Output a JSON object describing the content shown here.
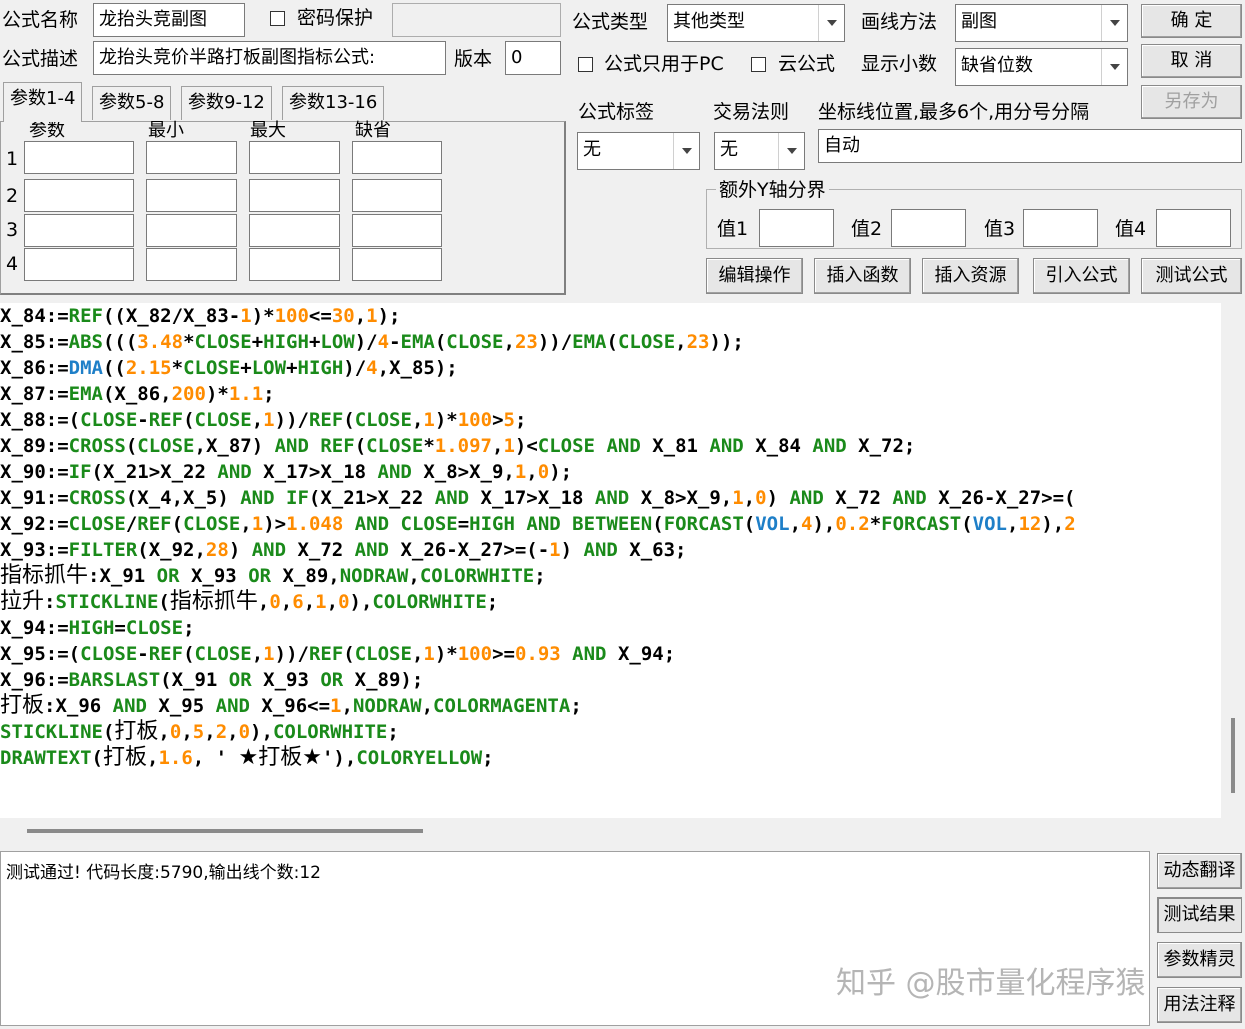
{
  "formula": {
    "name_label": "公式名称",
    "name_value": "龙抬头竞副图",
    "password_label": "密码保护",
    "desc_label": "公式描述",
    "desc_value": "龙抬头竞价半路打板副图指标公式:",
    "version_label": "版本",
    "version_value": "0",
    "type_label": "公式类型",
    "type_value": "其他类型",
    "draw_label": "画线方法",
    "draw_value": "副图",
    "pc_only_label": "公式只用于PC",
    "cloud_label": "云公式",
    "decimals_label": "显示小数",
    "decimals_value": "缺省位数",
    "tag_label": "公式标签",
    "tag_value": "无",
    "rule_label": "交易法则",
    "rule_value": "无",
    "axis_label": "坐标线位置,最多6个,用分号分隔",
    "axis_value": "自动"
  },
  "buttons": {
    "ok": "确  定",
    "cancel": "取  消",
    "save_as": "另存为",
    "edit": "编辑操作",
    "insert_func": "插入函数",
    "insert_res": "插入资源",
    "import": "引入公式",
    "test": "测试公式",
    "dyn_translate": "动态翻译",
    "test_result": "测试结果",
    "param_wizard": "参数精灵",
    "usage_notes": "用法注释"
  },
  "tabs": [
    "参数1-4",
    "参数5-8",
    "参数9-12",
    "参数13-16"
  ],
  "params": {
    "headers": [
      "参数",
      "最小",
      "最大",
      "缺省"
    ],
    "rows": [
      "1",
      "2",
      "3",
      "4"
    ]
  },
  "yaxis": {
    "group_label": "额外Y轴分界",
    "labels": [
      "值1",
      "值2",
      "值3",
      "值4"
    ]
  },
  "code_lines": [
    [
      [
        "X_84:=",
        "t"
      ],
      [
        "REF",
        "k"
      ],
      [
        "((X_82/X_83-",
        "t"
      ],
      [
        "1",
        "n"
      ],
      [
        ")*",
        "t"
      ],
      [
        "100",
        "n"
      ],
      [
        "<=",
        "t"
      ],
      [
        "30",
        "n"
      ],
      [
        ",",
        "t"
      ],
      [
        "1",
        "n"
      ],
      [
        ");",
        "t"
      ]
    ],
    [
      [
        "X_85:=",
        "t"
      ],
      [
        "ABS",
        "k"
      ],
      [
        "(((",
        "t"
      ],
      [
        "3.48",
        "n"
      ],
      [
        "*",
        "t"
      ],
      [
        "CLOSE",
        "k"
      ],
      [
        "+",
        "t"
      ],
      [
        "HIGH",
        "k"
      ],
      [
        "+",
        "t"
      ],
      [
        "LOW",
        "k"
      ],
      [
        ")/",
        "t"
      ],
      [
        "4",
        "n"
      ],
      [
        "-",
        "t"
      ],
      [
        "EMA",
        "k"
      ],
      [
        "(",
        "t"
      ],
      [
        "CLOSE",
        "k"
      ],
      [
        ",",
        "t"
      ],
      [
        "23",
        "n"
      ],
      [
        "))/",
        "t"
      ],
      [
        "EMA",
        "k"
      ],
      [
        "(",
        "t"
      ],
      [
        "CLOSE",
        "k"
      ],
      [
        ",",
        "t"
      ],
      [
        "23",
        "n"
      ],
      [
        "));",
        "t"
      ]
    ],
    [
      [
        "X_86:=",
        "t"
      ],
      [
        "DMA",
        "b"
      ],
      [
        "((",
        "t"
      ],
      [
        "2.15",
        "n"
      ],
      [
        "*",
        "t"
      ],
      [
        "CLOSE",
        "k"
      ],
      [
        "+",
        "t"
      ],
      [
        "LOW",
        "k"
      ],
      [
        "+",
        "t"
      ],
      [
        "HIGH",
        "k"
      ],
      [
        ")/",
        "t"
      ],
      [
        "4",
        "n"
      ],
      [
        ",X_85);",
        "t"
      ]
    ],
    [
      [
        "X_87:=",
        "t"
      ],
      [
        "EMA",
        "k"
      ],
      [
        "(X_86,",
        "t"
      ],
      [
        "200",
        "n"
      ],
      [
        ")*",
        "t"
      ],
      [
        "1.1",
        "n"
      ],
      [
        ";",
        "t"
      ]
    ],
    [
      [
        "X_88:=(",
        "t"
      ],
      [
        "CLOSE",
        "k"
      ],
      [
        "-",
        "t"
      ],
      [
        "REF",
        "k"
      ],
      [
        "(",
        "t"
      ],
      [
        "CLOSE",
        "k"
      ],
      [
        ",",
        "t"
      ],
      [
        "1",
        "n"
      ],
      [
        "))/",
        "t"
      ],
      [
        "REF",
        "k"
      ],
      [
        "(",
        "t"
      ],
      [
        "CLOSE",
        "k"
      ],
      [
        ",",
        "t"
      ],
      [
        "1",
        "n"
      ],
      [
        ")*",
        "t"
      ],
      [
        "100",
        "n"
      ],
      [
        ">",
        "t"
      ],
      [
        "5",
        "n"
      ],
      [
        ";",
        "t"
      ]
    ],
    [
      [
        "X_89:=",
        "t"
      ],
      [
        "CROSS",
        "k"
      ],
      [
        "(",
        "t"
      ],
      [
        "CLOSE",
        "k"
      ],
      [
        ",X_87) ",
        "t"
      ],
      [
        "AND",
        "k"
      ],
      [
        " ",
        "t"
      ],
      [
        "REF",
        "k"
      ],
      [
        "(",
        "t"
      ],
      [
        "CLOSE",
        "k"
      ],
      [
        "*",
        "t"
      ],
      [
        "1.097",
        "n"
      ],
      [
        ",",
        "t"
      ],
      [
        "1",
        "n"
      ],
      [
        ")<",
        "t"
      ],
      [
        "CLOSE",
        "k"
      ],
      [
        " ",
        "t"
      ],
      [
        "AND",
        "k"
      ],
      [
        " X_81 ",
        "t"
      ],
      [
        "AND",
        "k"
      ],
      [
        " X_84 ",
        "t"
      ],
      [
        "AND",
        "k"
      ],
      [
        " X_72;",
        "t"
      ]
    ],
    [
      [
        "X_90:=",
        "t"
      ],
      [
        "IF",
        "k"
      ],
      [
        "(X_21>X_22 ",
        "t"
      ],
      [
        "AND",
        "k"
      ],
      [
        " X_17>X_18 ",
        "t"
      ],
      [
        "AND",
        "k"
      ],
      [
        " X_8>X_9,",
        "t"
      ],
      [
        "1",
        "n"
      ],
      [
        ",",
        "t"
      ],
      [
        "0",
        "n"
      ],
      [
        ");",
        "t"
      ]
    ],
    [
      [
        "X_91:=",
        "t"
      ],
      [
        "CROSS",
        "k"
      ],
      [
        "(X_4,X_5) ",
        "t"
      ],
      [
        "AND",
        "k"
      ],
      [
        " ",
        "t"
      ],
      [
        "IF",
        "k"
      ],
      [
        "(X_21>X_22 ",
        "t"
      ],
      [
        "AND",
        "k"
      ],
      [
        " X_17>X_18 ",
        "t"
      ],
      [
        "AND",
        "k"
      ],
      [
        " X_8>X_9,",
        "t"
      ],
      [
        "1",
        "n"
      ],
      [
        ",",
        "t"
      ],
      [
        "0",
        "n"
      ],
      [
        ") ",
        "t"
      ],
      [
        "AND",
        "k"
      ],
      [
        " X_72 ",
        "t"
      ],
      [
        "AND",
        "k"
      ],
      [
        " X_26-X_27>=(",
        "t"
      ]
    ],
    [
      [
        "X_92:=",
        "t"
      ],
      [
        "CLOSE",
        "k"
      ],
      [
        "/",
        "t"
      ],
      [
        "REF",
        "k"
      ],
      [
        "(",
        "t"
      ],
      [
        "CLOSE",
        "k"
      ],
      [
        ",",
        "t"
      ],
      [
        "1",
        "n"
      ],
      [
        ")>",
        "t"
      ],
      [
        "1.048",
        "n"
      ],
      [
        " ",
        "t"
      ],
      [
        "AND",
        "k"
      ],
      [
        " ",
        "t"
      ],
      [
        "CLOSE",
        "k"
      ],
      [
        "=",
        "t"
      ],
      [
        "HIGH",
        "k"
      ],
      [
        " ",
        "t"
      ],
      [
        "AND",
        "k"
      ],
      [
        " ",
        "t"
      ],
      [
        "BETWEEN",
        "k"
      ],
      [
        "(",
        "t"
      ],
      [
        "FORCAST",
        "k"
      ],
      [
        "(",
        "t"
      ],
      [
        "VOL",
        "b"
      ],
      [
        ",",
        "t"
      ],
      [
        "4",
        "n"
      ],
      [
        "),",
        "t"
      ],
      [
        "0.2",
        "n"
      ],
      [
        "*",
        "t"
      ],
      [
        "FORCAST",
        "k"
      ],
      [
        "(",
        "t"
      ],
      [
        "VOL",
        "b"
      ],
      [
        ",",
        "t"
      ],
      [
        "12",
        "n"
      ],
      [
        "),",
        "t"
      ],
      [
        "2",
        "n"
      ]
    ],
    [
      [
        "X_93:=",
        "t"
      ],
      [
        "FILTER",
        "k"
      ],
      [
        "(X_92,",
        "t"
      ],
      [
        "28",
        "n"
      ],
      [
        ") ",
        "t"
      ],
      [
        "AND",
        "k"
      ],
      [
        " X_72 ",
        "t"
      ],
      [
        "AND",
        "k"
      ],
      [
        " X_26-X_27>=(-",
        "t"
      ],
      [
        "1",
        "n"
      ],
      [
        ") ",
        "t"
      ],
      [
        "AND",
        "k"
      ],
      [
        " X_63;",
        "t"
      ]
    ],
    [
      [
        "指标抓牛",
        "c"
      ],
      [
        ":X_91 ",
        "t"
      ],
      [
        "OR",
        "k"
      ],
      [
        " X_93 ",
        "t"
      ],
      [
        "OR",
        "k"
      ],
      [
        " X_89,",
        "t"
      ],
      [
        "NODRAW",
        "k"
      ],
      [
        ",",
        "t"
      ],
      [
        "COLORWHITE",
        "k"
      ],
      [
        ";",
        "t"
      ]
    ],
    [
      [
        "拉升",
        "c"
      ],
      [
        ":",
        "t"
      ],
      [
        "STICKLINE",
        "k"
      ],
      [
        "(",
        "t"
      ],
      [
        "指标抓牛",
        "c"
      ],
      [
        ",",
        "t"
      ],
      [
        "0",
        "n"
      ],
      [
        ",",
        "t"
      ],
      [
        "6",
        "n"
      ],
      [
        ",",
        "t"
      ],
      [
        "1",
        "n"
      ],
      [
        ",",
        "t"
      ],
      [
        "0",
        "n"
      ],
      [
        "),",
        "t"
      ],
      [
        "COLORWHITE",
        "k"
      ],
      [
        ";",
        "t"
      ]
    ],
    [
      [
        "X_94:=",
        "t"
      ],
      [
        "HIGH",
        "k"
      ],
      [
        "=",
        "t"
      ],
      [
        "CLOSE",
        "k"
      ],
      [
        ";",
        "t"
      ]
    ],
    [
      [
        "X_95:=(",
        "t"
      ],
      [
        "CLOSE",
        "k"
      ],
      [
        "-",
        "t"
      ],
      [
        "REF",
        "k"
      ],
      [
        "(",
        "t"
      ],
      [
        "CLOSE",
        "k"
      ],
      [
        ",",
        "t"
      ],
      [
        "1",
        "n"
      ],
      [
        "))/",
        "t"
      ],
      [
        "REF",
        "k"
      ],
      [
        "(",
        "t"
      ],
      [
        "CLOSE",
        "k"
      ],
      [
        ",",
        "t"
      ],
      [
        "1",
        "n"
      ],
      [
        ")*",
        "t"
      ],
      [
        "100",
        "n"
      ],
      [
        ">=",
        "t"
      ],
      [
        "0.93",
        "n"
      ],
      [
        " ",
        "t"
      ],
      [
        "AND",
        "k"
      ],
      [
        " X_94;",
        "t"
      ]
    ],
    [
      [
        "X_96:=",
        "t"
      ],
      [
        "BARSLAST",
        "k"
      ],
      [
        "(X_91 ",
        "t"
      ],
      [
        "OR",
        "k"
      ],
      [
        " X_93 ",
        "t"
      ],
      [
        "OR",
        "k"
      ],
      [
        " X_89);",
        "t"
      ]
    ],
    [
      [
        "打板",
        "c"
      ],
      [
        ":X_96 ",
        "t"
      ],
      [
        "AND",
        "k"
      ],
      [
        " X_95 ",
        "t"
      ],
      [
        "AND",
        "k"
      ],
      [
        " X_96<=",
        "t"
      ],
      [
        "1",
        "n"
      ],
      [
        ",",
        "t"
      ],
      [
        "NODRAW",
        "k"
      ],
      [
        ",",
        "t"
      ],
      [
        "COLORMAGENTA",
        "k"
      ],
      [
        ";",
        "t"
      ]
    ],
    [
      [
        "STICKLINE",
        "k"
      ],
      [
        "(",
        "t"
      ],
      [
        "打板",
        "c"
      ],
      [
        ",",
        "t"
      ],
      [
        "0",
        "n"
      ],
      [
        ",",
        "t"
      ],
      [
        "5",
        "n"
      ],
      [
        ",",
        "t"
      ],
      [
        "2",
        "n"
      ],
      [
        ",",
        "t"
      ],
      [
        "0",
        "n"
      ],
      [
        "),",
        "t"
      ],
      [
        "COLORWHITE",
        "k"
      ],
      [
        ";",
        "t"
      ]
    ],
    [
      [
        "DRAWTEXT",
        "k"
      ],
      [
        "(",
        "t"
      ],
      [
        "打板",
        "c"
      ],
      [
        ",",
        "t"
      ],
      [
        "1.6",
        "n"
      ],
      [
        ", ' ",
        "t"
      ],
      [
        "★打板★",
        "c"
      ],
      [
        "'),",
        "t"
      ],
      [
        "COLORYELLOW",
        "k"
      ],
      [
        ";",
        "t"
      ]
    ]
  ],
  "output": {
    "message": "测试通过! 代码长度:5790,输出线个数:12"
  },
  "watermark": "知乎 @股市量化程序猿",
  "colors": {
    "keyword": "#1a8a1a",
    "number": "#ff8c00",
    "builtin_blue": "#1e7fc8"
  }
}
